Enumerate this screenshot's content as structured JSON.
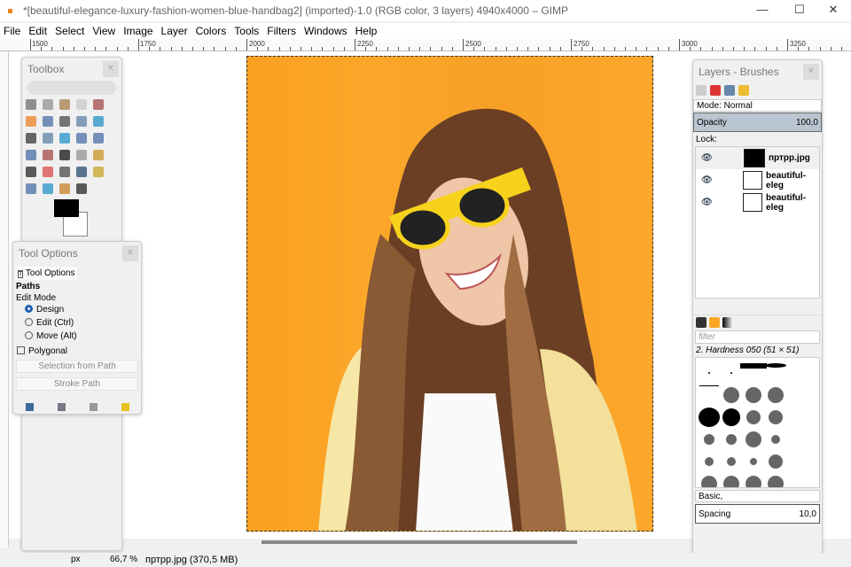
{
  "window": {
    "title": "*[beautiful-elegance-luxury-fashion-women-blue-handbag2] (imported)-1.0 (RGB color, 3 layers) 4940x4000 – GIMP",
    "minimize": "—",
    "maximize": "☐",
    "close": "✕"
  },
  "menu": [
    "File",
    "Edit",
    "Select",
    "View",
    "Image",
    "Layer",
    "Colors",
    "Tools",
    "Filters",
    "Windows",
    "Help"
  ],
  "ruler": [
    "1500",
    "1750",
    "2000",
    "2250",
    "2500",
    "2750",
    "3000",
    "3250"
  ],
  "toolbox": {
    "title": "Toolbox",
    "fg_color": "#000000",
    "bg_color": "#ffffff"
  },
  "tool_options": {
    "title": "Tool Options",
    "tab": "Tool Options",
    "tool": "Paths",
    "edit_mode_label": "Edit Mode",
    "modes": [
      "Design",
      "Edit (Ctrl)",
      "Move (Alt)"
    ],
    "selected_mode": "Design",
    "polygonal": "Polygonal",
    "polygonal_checked": false,
    "selection_from_path": "Selection from Path",
    "stroke_path": "Stroke Path"
  },
  "layers": {
    "title": "Layers - Brushes",
    "mode": "Mode: Normal",
    "opacity_label": "Opacity",
    "opacity_value": "100,0",
    "lock_label": "Lock:",
    "items": [
      {
        "name": "пртрр.jpg",
        "visible": true
      },
      {
        "name": "beautiful-eleg",
        "visible": true
      },
      {
        "name": "beautiful-eleg",
        "visible": true
      }
    ]
  },
  "brushes": {
    "filter_placeholder": "filter",
    "selected": "2. Hardness 050 (51 × 51)",
    "preset": "Basic,",
    "spacing_label": "Spacing",
    "spacing_value": "10,0"
  },
  "status": {
    "unit": "px",
    "zoom": "66,7 %",
    "info": "пртрр.jpg (370,5 MB)"
  },
  "colors": {
    "background": "#f9a021",
    "accent": "#1a5fb4"
  }
}
